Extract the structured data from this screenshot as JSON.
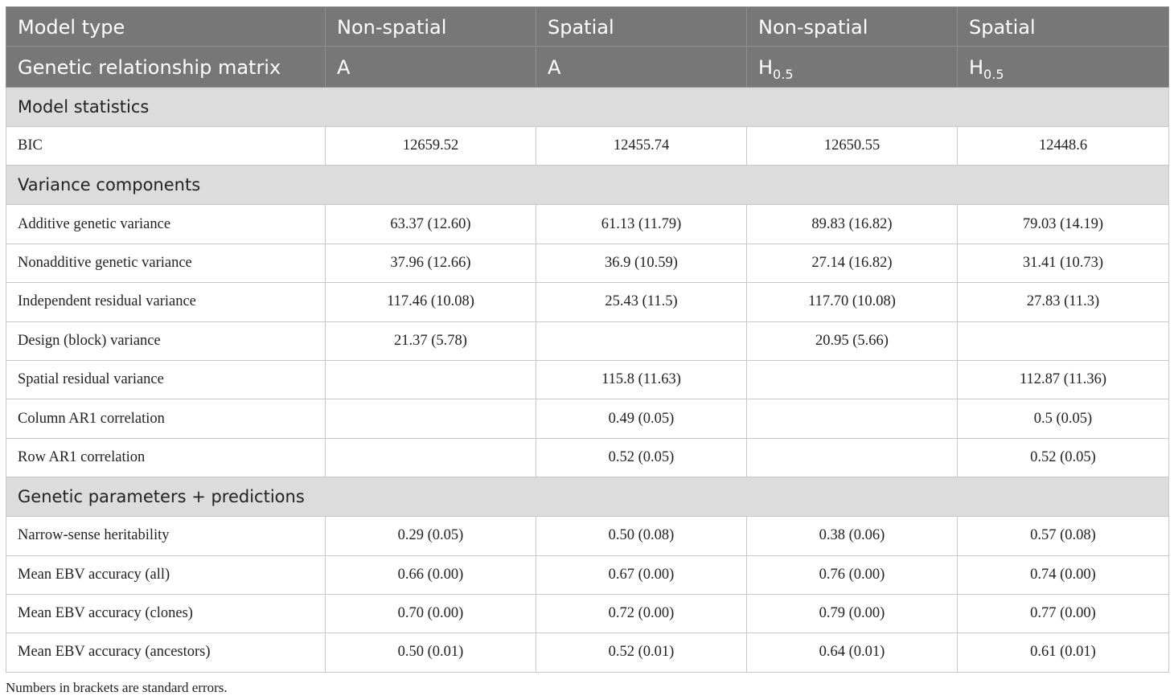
{
  "header": {
    "row1": {
      "label": "Model type",
      "cols": [
        "Non-spatial",
        "Spatial",
        "Non-spatial",
        "Spatial"
      ]
    },
    "row2": {
      "label": "Genetic relationship matrix",
      "cols": [
        {
          "main": "A",
          "sub": ""
        },
        {
          "main": "A",
          "sub": ""
        },
        {
          "main": "H",
          "sub": "0.5"
        },
        {
          "main": "H",
          "sub": "0.5"
        }
      ]
    }
  },
  "sections": [
    {
      "title": "Model statistics",
      "rows": [
        {
          "label": "BIC",
          "values": [
            "12659.52",
            "12455.74",
            "12650.55",
            "12448.6"
          ]
        }
      ]
    },
    {
      "title": "Variance components",
      "rows": [
        {
          "label": "Additive genetic variance",
          "values": [
            "63.37 (12.60)",
            "61.13 (11.79)",
            "89.83 (16.82)",
            "79.03 (14.19)"
          ]
        },
        {
          "label": "Nonadditive genetic variance",
          "values": [
            "37.96 (12.66)",
            "36.9 (10.59)",
            "27.14 (16.82)",
            "31.41 (10.73)"
          ]
        },
        {
          "label": "Independent residual variance",
          "values": [
            "117.46 (10.08)",
            "25.43 (11.5)",
            "117.70 (10.08)",
            "27.83 (11.3)"
          ]
        },
        {
          "label": "Design (block) variance",
          "values": [
            "21.37 (5.78)",
            "",
            "20.95 (5.66)",
            ""
          ]
        },
        {
          "label": "Spatial residual variance",
          "values": [
            "",
            "115.8 (11.63)",
            "",
            "112.87 (11.36)"
          ]
        },
        {
          "label": "Column AR1 correlation",
          "values": [
            "",
            "0.49 (0.05)",
            "",
            "0.5 (0.05)"
          ]
        },
        {
          "label": "Row AR1 correlation",
          "values": [
            "",
            "0.52 (0.05)",
            "",
            "0.52 (0.05)"
          ]
        }
      ]
    },
    {
      "title": "Genetic parameters + predictions",
      "rows": [
        {
          "label": "Narrow-sense heritability",
          "values": [
            "0.29 (0.05)",
            "0.50 (0.08)",
            "0.38 (0.06)",
            "0.57 (0.08)"
          ]
        },
        {
          "label": "Mean EBV accuracy (all)",
          "values": [
            "0.66 (0.00)",
            "0.67 (0.00)",
            "0.76 (0.00)",
            "0.74 (0.00)"
          ]
        },
        {
          "label": "Mean EBV accuracy (clones)",
          "values": [
            "0.70 (0.00)",
            "0.72 (0.00)",
            "0.79 (0.00)",
            "0.77 (0.00)"
          ]
        },
        {
          "label": "Mean EBV accuracy (ancestors)",
          "values": [
            "0.50 (0.01)",
            "0.52 (0.01)",
            "0.64 (0.01)",
            "0.61 (0.01)"
          ]
        }
      ]
    }
  ],
  "footnote": "Numbers in brackets are standard errors.",
  "colors": {
    "header_bg": "#777777",
    "header_text": "#ffffff",
    "section_bg": "#dcdcdc",
    "border": "#c8c8c8"
  }
}
